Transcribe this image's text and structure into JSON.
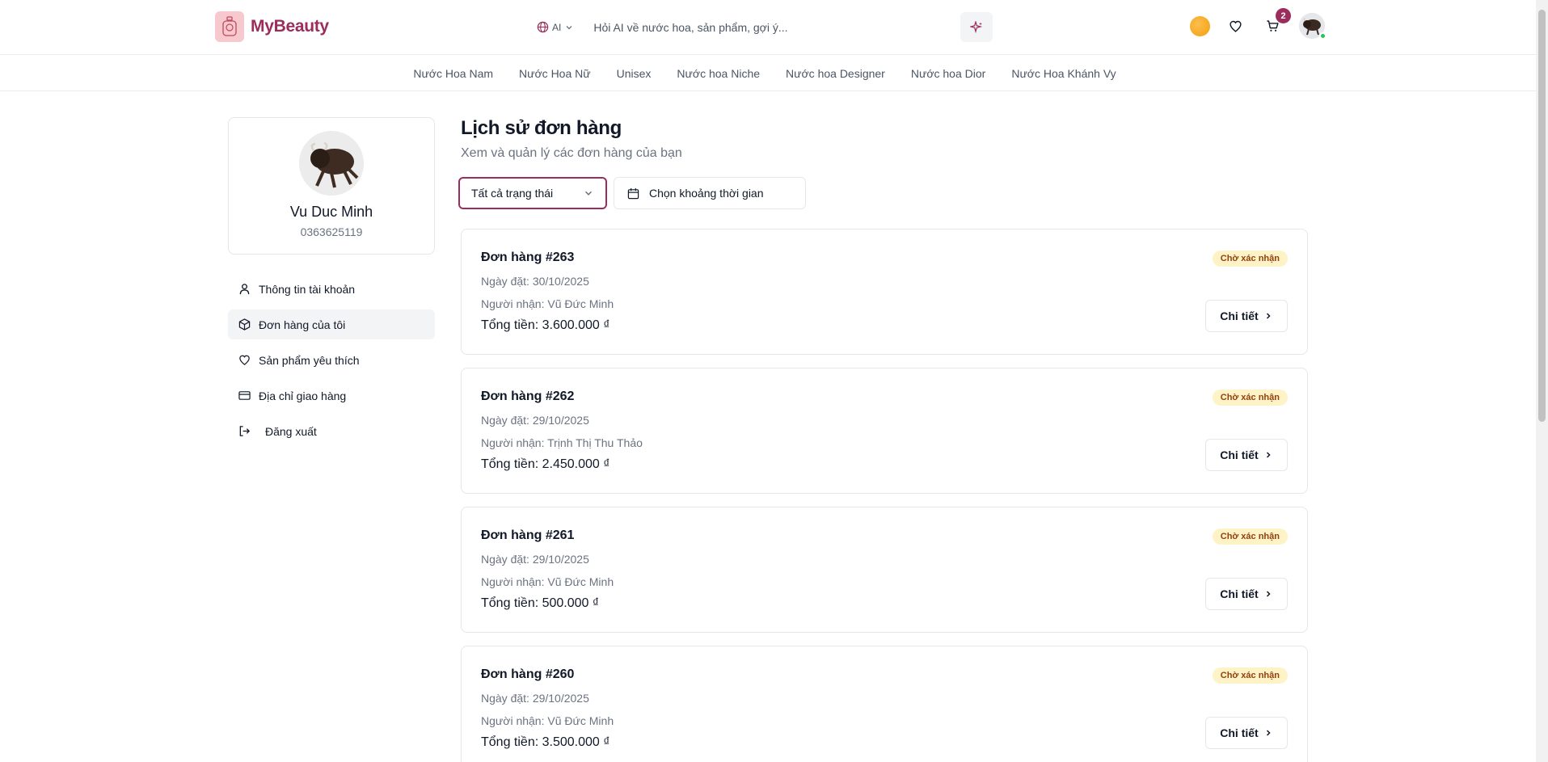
{
  "header": {
    "brand": "MyBeauty",
    "ai_label": "AI",
    "search_placeholder": "Hỏi AI về nước hoa, sản phẩm, gợi ý...",
    "cart_count": "2"
  },
  "nav": {
    "items": [
      "Nước Hoa Nam",
      "Nước Hoa Nữ",
      "Unisex",
      "Nước hoa Niche",
      "Nước hoa Designer",
      "Nước hoa Dior",
      "Nước Hoa Khánh Vy"
    ]
  },
  "profile": {
    "name": "Vu Duc Minh",
    "phone": "0363625119"
  },
  "menu": {
    "items": [
      "Thông tin tài khoản",
      "Đơn hàng của tôi",
      "Sản phẩm yêu thích",
      "Địa chỉ giao hàng",
      "Đăng xuất"
    ],
    "active": "Đơn hàng của tôi"
  },
  "main": {
    "title": "Lịch sử đơn hàng",
    "subtitle": "Xem và quản lý các đơn hàng của bạn",
    "status_filter": "Tất cả trạng thái",
    "date_filter": "Chọn khoảng thời gian"
  },
  "orders": [
    {
      "id": "Đơn hàng #263",
      "date": "Ngày đặt: 30/10/2025",
      "recipient": "Người nhận: Vũ Đức Minh",
      "total": "Tổng tiền: 3.600.000 ₫",
      "status": "Chờ xác nhận",
      "detail_label": "Chi tiết"
    },
    {
      "id": "Đơn hàng #262",
      "date": "Ngày đặt: 29/10/2025",
      "recipient": "Người nhận: Trịnh Thị Thu Thảo",
      "total": "Tổng tiền: 2.450.000 ₫",
      "status": "Chờ xác nhận",
      "detail_label": "Chi tiết"
    },
    {
      "id": "Đơn hàng #261",
      "date": "Ngày đặt: 29/10/2025",
      "recipient": "Người nhận: Vũ Đức Minh",
      "total": "Tổng tiền: 500.000 ₫",
      "status": "Chờ xác nhận",
      "detail_label": "Chi tiết"
    },
    {
      "id": "Đơn hàng #260",
      "date": "Ngày đặt: 29/10/2025",
      "recipient": "Người nhận: Vũ Đức Minh",
      "total": "Tổng tiền: 3.500.000 ₫",
      "status": "Chờ xác nhận",
      "detail_label": "Chi tiết"
    }
  ],
  "colors": {
    "brand": "#9b2d5c",
    "badge_bg": "#fef3c7",
    "badge_text": "#92400e",
    "online": "#22c55e"
  }
}
